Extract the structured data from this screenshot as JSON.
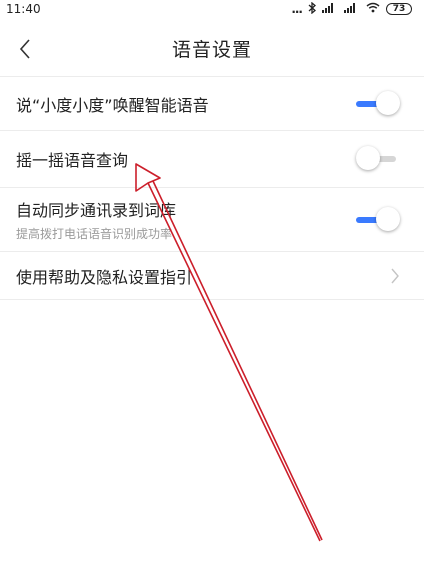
{
  "status_bar": {
    "time": "11:40",
    "dots": "...",
    "battery": "73"
  },
  "header": {
    "title": "语音设置"
  },
  "settings": {
    "wake_voice": {
      "label": "说“小度小度”唤醒智能语音",
      "enabled": true
    },
    "shake_query": {
      "label": "摇一摇语音查询",
      "enabled": false
    },
    "sync_contacts": {
      "label": "自动同步通讯录到词库",
      "sublabel": "提高拨打电话语音识别成功率",
      "enabled": true
    },
    "help_privacy": {
      "label": "使用帮助及隐私设置指引"
    }
  },
  "colors": {
    "accent": "#3a7afe",
    "toggle_off": "#d6d6d6",
    "annotation": "#cc1f2b"
  },
  "icons": {
    "back": "chevron-left-icon",
    "chevron": "chevron-right-icon"
  }
}
